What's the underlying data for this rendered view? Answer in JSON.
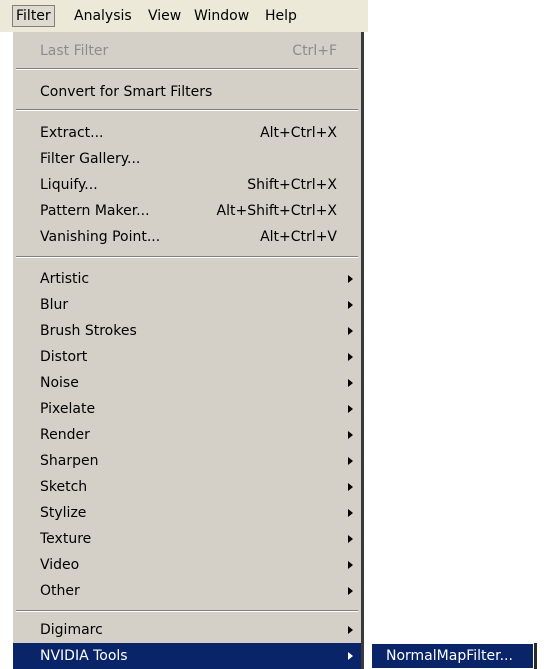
{
  "menubar": {
    "items": [
      "Filter",
      "Analysis",
      "View",
      "Window",
      "Help"
    ]
  },
  "menu": {
    "last_filter": {
      "label": "Last Filter",
      "shortcut": "Ctrl+F"
    },
    "convert_smart": {
      "label": "Convert for Smart Filters"
    },
    "extract": {
      "label": "Extract...",
      "shortcut": "Alt+Ctrl+X"
    },
    "filter_gallery": {
      "label": "Filter Gallery..."
    },
    "liquify": {
      "label": "Liquify...",
      "shortcut": "Shift+Ctrl+X"
    },
    "pattern_maker": {
      "label": "Pattern Maker...",
      "shortcut": "Alt+Shift+Ctrl+X"
    },
    "vanishing_point": {
      "label": "Vanishing Point...",
      "shortcut": "Alt+Ctrl+V"
    },
    "categories": [
      "Artistic",
      "Blur",
      "Brush Strokes",
      "Distort",
      "Noise",
      "Pixelate",
      "Render",
      "Sharpen",
      "Sketch",
      "Stylize",
      "Texture",
      "Video",
      "Other"
    ],
    "digimarc": {
      "label": "Digimarc"
    },
    "nvidia_tools": {
      "label": "NVIDIA Tools"
    }
  },
  "submenu": {
    "normal_map_filter": {
      "label": "NormalMapFilter..."
    }
  },
  "colors": {
    "menu_bg": "#d4d0c8",
    "highlight": "#0a246a",
    "disabled_text": "#8c8c8c"
  }
}
